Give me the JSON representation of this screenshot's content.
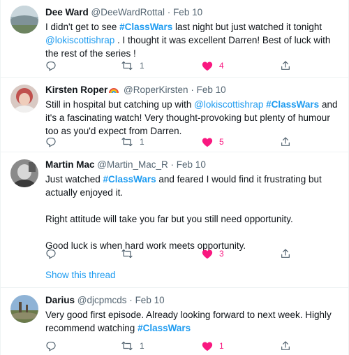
{
  "tweets": [
    {
      "name": "Dee Ward",
      "handle": "@DeeWardRottal",
      "sep": "·",
      "date": "Feb 10",
      "text_1": "I didn't get to see ",
      "tag_1": "#ClassWars",
      "text_2": " last night but just watched it tonight ",
      "mention": "@lokiscottishrap",
      "text_3": " . I thought it was excellent Darren! Best of luck with the rest of the series !",
      "retweets": "1",
      "likes": "4"
    },
    {
      "name": "Kirsten Roper",
      "handle": "@RoperKirsten",
      "sep": "·",
      "date": "Feb 10",
      "text_1": "Still in hospital but catching up with ",
      "mention": "@lokiscottishrap",
      "text_2": " ",
      "tag_1": "#ClassWars",
      "text_3": " and it's a fascinating watch! Very thought-provoking but plenty of humour too as you'd expect from Darren.",
      "retweets": "1",
      "likes": "5"
    },
    {
      "name": "Martin Mac",
      "handle": "@Martin_Mac_R",
      "sep": "·",
      "date": "Feb 10",
      "text_1": "Just watched ",
      "tag_1": "#ClassWars",
      "text_2": " and feared I would find it frustrating but actually enjoyed it.",
      "para_2": "Right attitude will take you far but you still need opportunity.",
      "para_3": "Good luck is when hard work meets opportunity.",
      "retweets": "",
      "likes": "3",
      "thread_link": "Show this thread"
    },
    {
      "name": "Darius",
      "handle": "@djcpmcds",
      "sep": "·",
      "date": "Feb 10",
      "text_1": "Very good first episode. Already looking forward to next week. Highly recommend watching ",
      "tag_1": "#ClassWars",
      "retweets": "1",
      "likes": "1"
    }
  ],
  "icons": {
    "reply": "reply-icon",
    "retweet": "retweet-icon",
    "like": "heart-filled-icon",
    "share": "share-icon",
    "badge": "rainbow-emoji"
  },
  "colors": {
    "link": "#1d9bf0",
    "like": "#f91880",
    "muted": "#536471",
    "text": "#0f1419"
  }
}
